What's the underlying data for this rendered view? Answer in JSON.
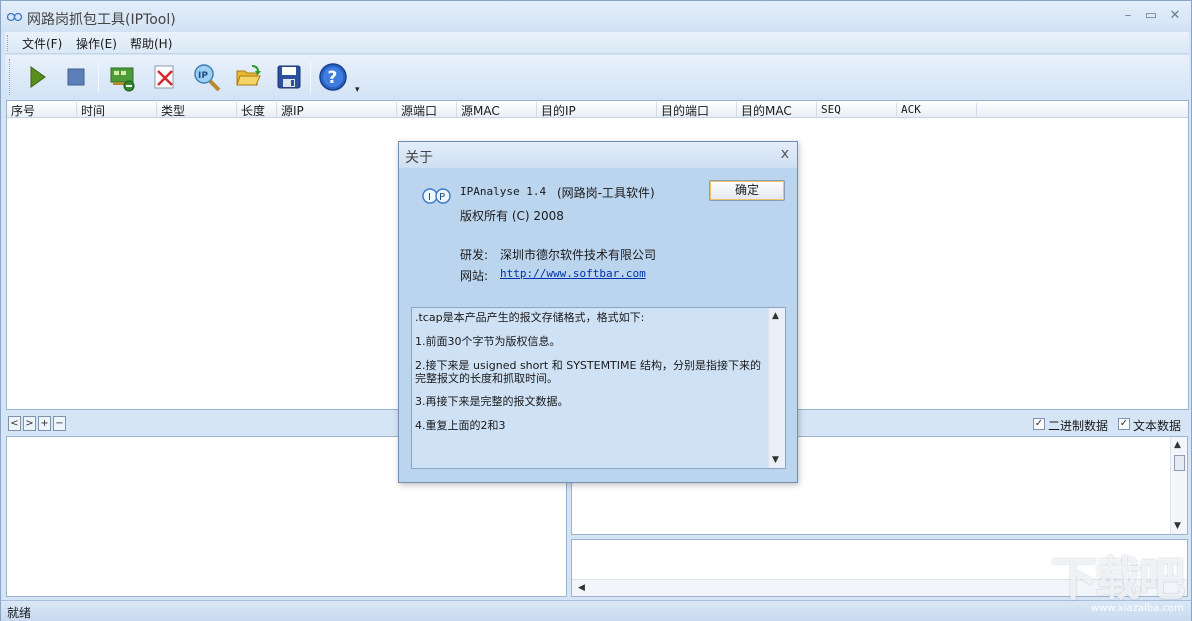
{
  "window": {
    "title": "网路岗抓包工具(IPTool)",
    "controls": {
      "minimize": "–",
      "maximize": "▭",
      "close": "✕"
    }
  },
  "menu": [
    {
      "label": "文件(F)"
    },
    {
      "label": "操作(E)"
    },
    {
      "label": "帮助(H)"
    }
  ],
  "toolbar": {
    "buttons": [
      {
        "name": "start",
        "icon": "play-icon"
      },
      {
        "name": "stop",
        "icon": "stop-icon"
      },
      {
        "name": "network-card",
        "icon": "network-card-icon"
      },
      {
        "name": "clear",
        "icon": "clear-icon"
      },
      {
        "name": "ip-search",
        "icon": "ip-search-icon"
      },
      {
        "name": "open",
        "icon": "folder-open-icon"
      },
      {
        "name": "save",
        "icon": "save-icon"
      },
      {
        "name": "help",
        "icon": "help-icon"
      }
    ],
    "overflow": "▾"
  },
  "packet_list": {
    "columns": [
      "序号",
      "时间",
      "类型",
      "长度",
      "源IP",
      "源端口",
      "源MAC",
      "目的IP",
      "目的端口",
      "目的MAC",
      "SEQ",
      "ACK"
    ]
  },
  "lower": {
    "nav_buttons": [
      "<",
      ">",
      "+",
      "−"
    ],
    "binary_label": "二进制数据",
    "text_label": "文本数据",
    "binary_checked": true,
    "text_checked": true
  },
  "status": {
    "text": "就绪"
  },
  "about_dialog": {
    "title": "关于",
    "close": "x",
    "product": "IPAnalyse 1.4",
    "product_note": "(网路岗-工具软件)",
    "copyright": "版权所有 (C) 2008",
    "developer_label": "研发:",
    "developer": "深圳市德尔软件技术有限公司",
    "website_label": "网站:",
    "website": "http://www.softbar.com",
    "ok_button": "确定",
    "info_lines": [
      ".tcap是本产品产生的报文存储格式，格式如下:",
      "1.前面30个字节为版权信息。",
      "2.接下来是 usigned short  和 SYSTEMTIME 结构，分别是指接下来的完整报文的长度和抓取时间。",
      "3.再接下来是完整的报文数据。",
      "4.重复上面的2和3"
    ]
  },
  "watermark": {
    "big": "下载吧",
    "small": "www.xiazaiba.com"
  }
}
